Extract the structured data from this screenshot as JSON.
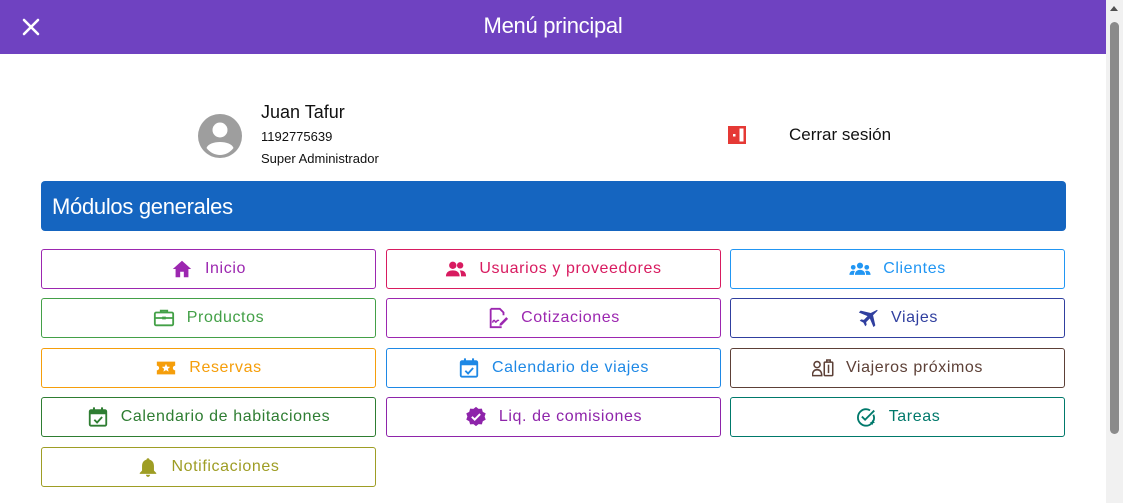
{
  "header": {
    "title": "Menú principal",
    "close_icon": "close-icon",
    "background": "#6f42c1"
  },
  "user": {
    "name": "Juan Tafur",
    "id_number": "1192775639",
    "role": "Super Administrador",
    "avatar_icon": "account-circle-icon"
  },
  "logout": {
    "label": "Cerrar sesión",
    "icon": "door-exit-icon",
    "color": "#e53935"
  },
  "section": {
    "title": "Módulos generales",
    "background": "#1565c0"
  },
  "modules": [
    {
      "label": "Inicio",
      "icon": "home-icon",
      "color": "#9c27b0"
    },
    {
      "label": "Usuarios y proveedores",
      "icon": "users-icon",
      "color": "#d81b60"
    },
    {
      "label": "Clientes",
      "icon": "clients-group-icon",
      "color": "#2196f3"
    },
    {
      "label": "Productos",
      "icon": "briefcase-icon",
      "color": "#43a047"
    },
    {
      "label": "Cotizaciones",
      "icon": "signature-icon",
      "color": "#9c27b0"
    },
    {
      "label": "Viajes",
      "icon": "airplane-icon",
      "color": "#303f9f"
    },
    {
      "label": "Reservas",
      "icon": "ticket-star-icon",
      "color": "#f59e0b"
    },
    {
      "label": "Calendario de viajes",
      "icon": "calendar-check-icon",
      "color": "#1e88e5"
    },
    {
      "label": "Viajeros próximos",
      "icon": "traveler-luggage-icon",
      "color": "#5d4037"
    },
    {
      "label": "Calendario de habitaciones",
      "icon": "calendar-check-icon",
      "color": "#2e7d32"
    },
    {
      "label": "Liq. de comisiones",
      "icon": "verified-badge-icon",
      "color": "#8e24aa"
    },
    {
      "label": "Tareas",
      "icon": "task-check-icon",
      "color": "#00796b"
    },
    {
      "label": "Notificaciones",
      "icon": "bell-icon",
      "color": "#9e9d24"
    }
  ]
}
